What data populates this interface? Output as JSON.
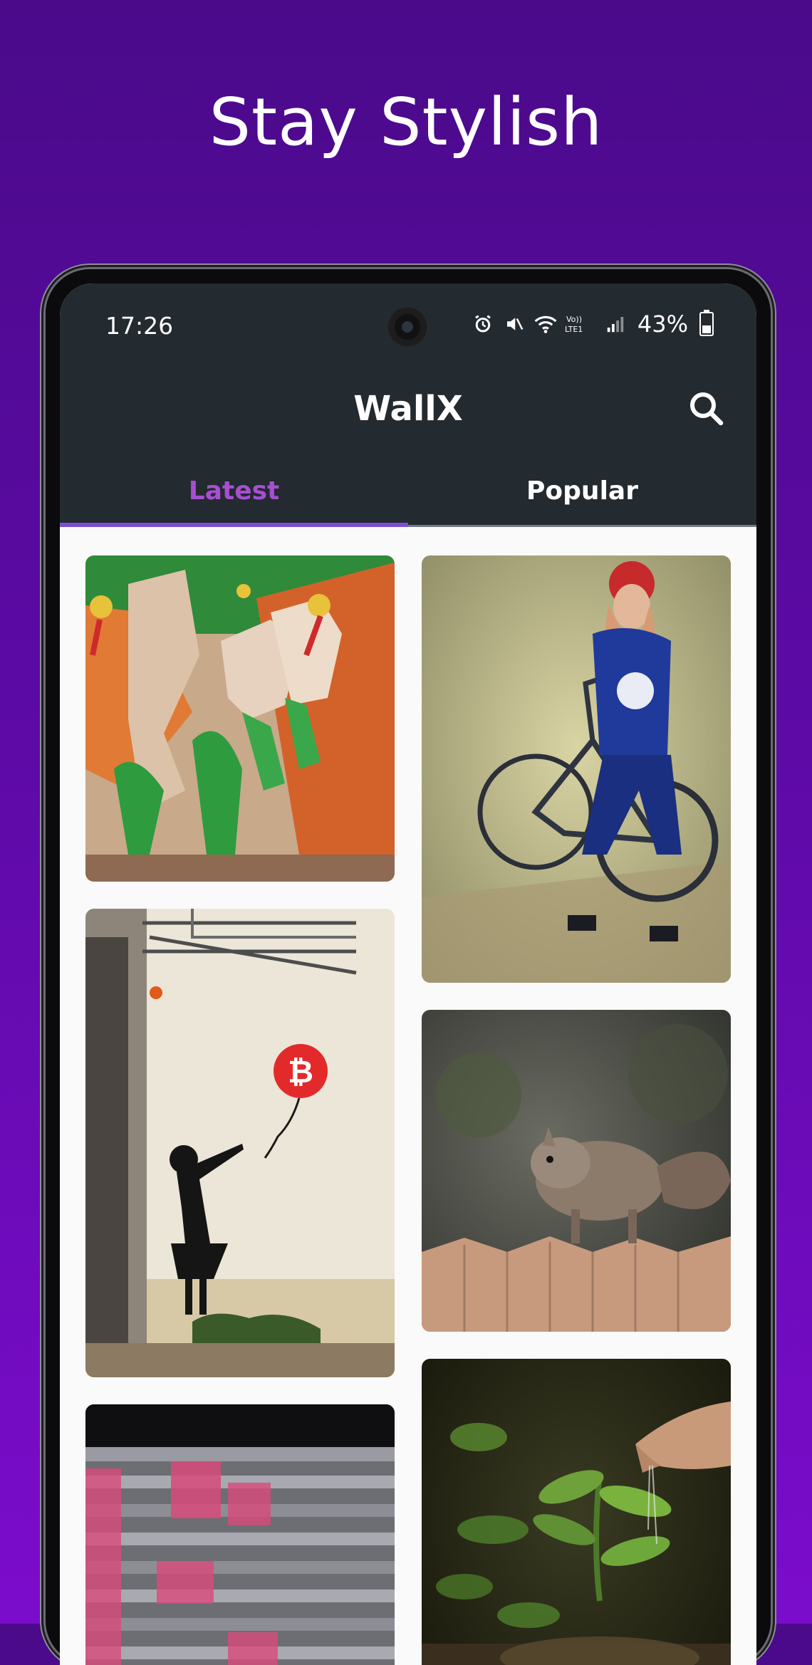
{
  "promo": {
    "headline": "Stay Stylish"
  },
  "status_bar": {
    "time": "17:26",
    "battery_percent": "43%",
    "signal_label": "Vo) LTE1"
  },
  "app": {
    "title": "WallX"
  },
  "tabs": [
    {
      "label": "Latest",
      "selected": true
    },
    {
      "label": "Popular",
      "selected": false
    }
  ],
  "wallpapers": [
    {
      "name": "abstract-mural"
    },
    {
      "name": "girl-with-bicycle"
    },
    {
      "name": "girl-with-bitcoin-balloon"
    },
    {
      "name": "squirrel-on-fence"
    },
    {
      "name": "stacked-banknotes"
    },
    {
      "name": "watering-seedling"
    }
  ],
  "colors": {
    "background_top": "#4a0a8a",
    "background_bottom": "#7b0ccc",
    "appbar": "#232a30",
    "tab_selected": "#a64fd1",
    "tab_indicator": "#7b4fd1"
  },
  "icons": [
    "search-icon",
    "alarm-icon",
    "mute-icon",
    "wifi-icon",
    "signal-icon",
    "battery-icon"
  ]
}
